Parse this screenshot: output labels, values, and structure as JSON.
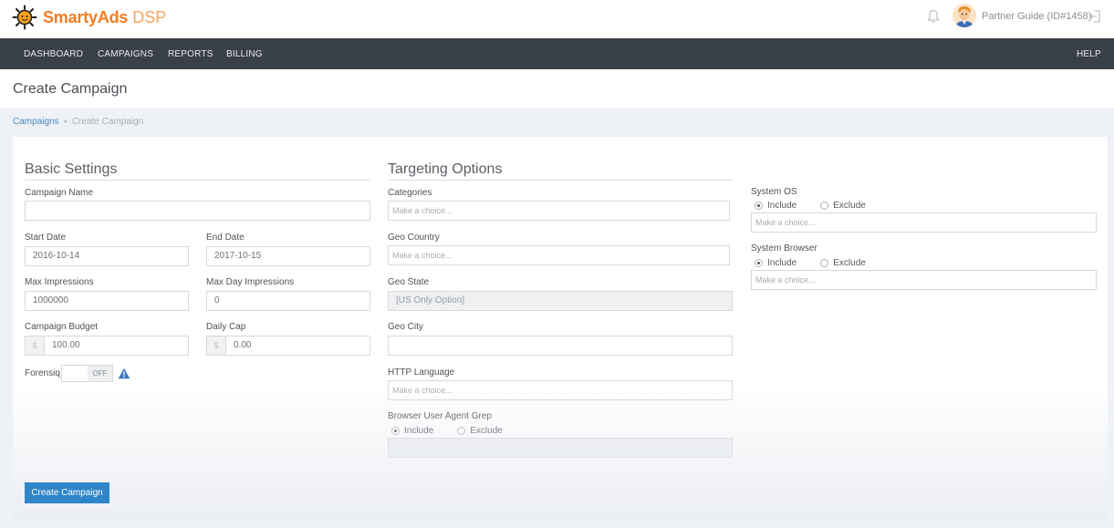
{
  "app": {
    "brand": "SmartyAds",
    "product": "DSP",
    "user_label": "Partner Guide (ID#1458)"
  },
  "nav": {
    "items": [
      "DASHBOARD",
      "CAMPAIGNS",
      "REPORTS",
      "BILLING"
    ],
    "help": "HELP"
  },
  "page": {
    "title": "Create Campaign"
  },
  "breadcrumb": {
    "parent": "Campaigns",
    "current": "Create Campaign"
  },
  "basic": {
    "title": "Basic Settings",
    "campaign_name": {
      "label": "Campaign Name",
      "value": ""
    },
    "start_date": {
      "label": "Start Date",
      "value": "2016-10-14"
    },
    "end_date": {
      "label": "End Date",
      "value": "2017-10-15"
    },
    "max_impressions": {
      "label": "Max Impressions",
      "value": "1000000"
    },
    "max_day_impressions": {
      "label": "Max Day Impressions",
      "value": "0"
    },
    "campaign_budget": {
      "label": "Campaign Budget",
      "currency": "$",
      "value": "100.00"
    },
    "daily_cap": {
      "label": "Daily Cap",
      "currency": "$",
      "value": "0.00"
    },
    "forensiq": {
      "label": "Forensiq",
      "state": "OFF"
    }
  },
  "targeting": {
    "title": "Targeting Options",
    "categories": {
      "label": "Categories",
      "placeholder": "Make a choice..."
    },
    "geo_country": {
      "label": "Geo Country",
      "placeholder": "Make a choice..."
    },
    "geo_state": {
      "label": "Geo State",
      "value": "[US Only Option]"
    },
    "geo_city": {
      "label": "Geo City",
      "value": ""
    },
    "http_language": {
      "label": "HTTP Language",
      "placeholder": "Make a choice..."
    },
    "browser_ua_grep": {
      "label": "Browser User Agent Grep",
      "include": "Include",
      "exclude": "Exclude",
      "selected": "include"
    }
  },
  "system": {
    "os": {
      "label": "System OS",
      "include": "Include",
      "exclude": "Exclude",
      "placeholder": "Make a choice...",
      "selected": "include"
    },
    "browser": {
      "label": "System Browser",
      "include": "Include",
      "exclude": "Exclude",
      "placeholder": "Make a choice...",
      "selected": "include"
    }
  },
  "actions": {
    "create": "Create Campaign"
  },
  "colors": {
    "brand_orange": "#f47b20",
    "nav_bg": "#3a4049",
    "primary_button": "#2f86c9",
    "link": "#4a8ac4"
  },
  "icons": [
    "sun-logo-icon",
    "bell-icon",
    "user-avatar-icon",
    "logout-icon",
    "warning-icon"
  ]
}
